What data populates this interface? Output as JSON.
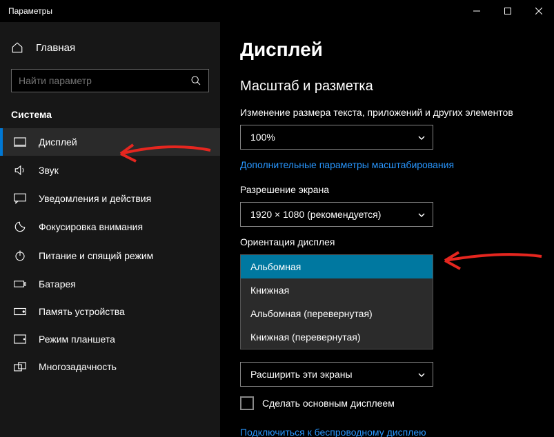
{
  "window": {
    "title": "Параметры"
  },
  "sidebar": {
    "home": "Главная",
    "search_placeholder": "Найти параметр",
    "section": "Система",
    "items": [
      {
        "label": "Дисплей"
      },
      {
        "label": "Звук"
      },
      {
        "label": "Уведомления и действия"
      },
      {
        "label": "Фокусировка внимания"
      },
      {
        "label": "Питание и спящий режим"
      },
      {
        "label": "Батарея"
      },
      {
        "label": "Память устройства"
      },
      {
        "label": "Режим планшета"
      },
      {
        "label": "Многозадачность"
      }
    ]
  },
  "main": {
    "title": "Дисплей",
    "scale_heading": "Масштаб и разметка",
    "scale_label": "Изменение размера текста, приложений и других элементов",
    "scale_value": "100%",
    "advanced_scale_link": "Дополнительные параметры масштабирования",
    "resolution_label": "Разрешение экрана",
    "resolution_value": "1920 × 1080 (рекомендуется)",
    "orientation_label": "Ориентация дисплея",
    "orientation_options": [
      "Альбомная",
      "Книжная",
      "Альбомная (перевернутая)",
      "Книжная (перевернутая)"
    ],
    "multidisplay_value": "Расширить эти экраны",
    "make_primary_label": "Сделать основным дисплеем",
    "wireless_link": "Подключиться к беспроводному дисплею"
  }
}
